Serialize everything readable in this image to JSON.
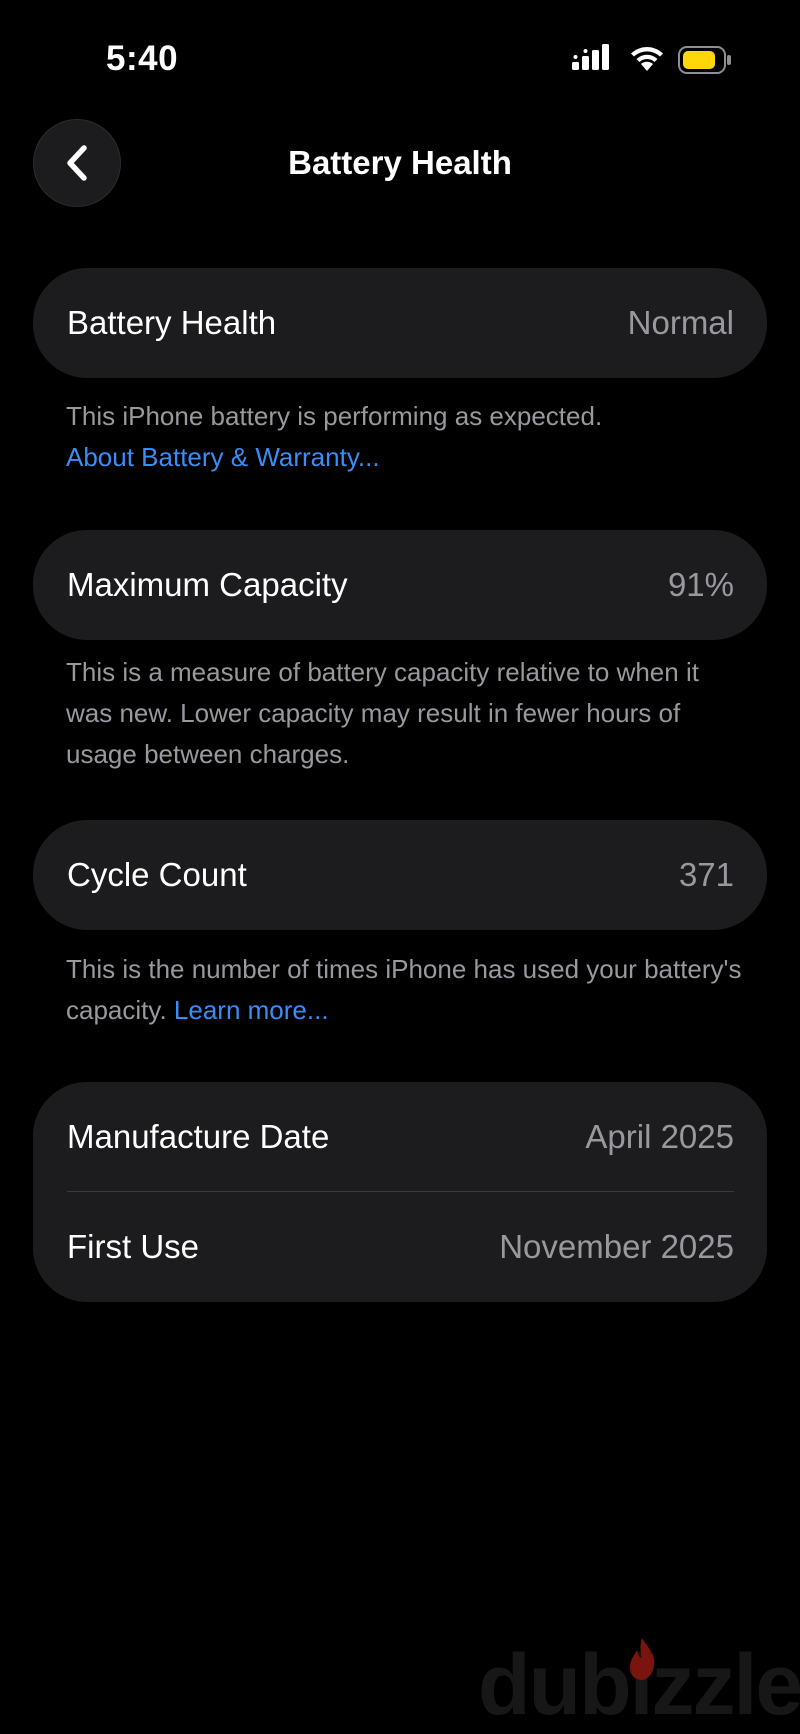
{
  "status_bar": {
    "time": "5:40",
    "icons": [
      "signal-icon",
      "wifi-icon",
      "battery-icon"
    ],
    "battery_color": "#ffd60a"
  },
  "nav": {
    "back_icon": "chevron-left-icon",
    "title": "Battery Health"
  },
  "battery_health": {
    "label": "Battery Health",
    "value": "Normal",
    "footer_text": "This iPhone battery is performing as expected.",
    "footer_link": "About Battery & Warranty..."
  },
  "maximum_capacity": {
    "label": "Maximum Capacity",
    "value": "91%",
    "footer_text": "This is a measure of battery capacity relative to when it was new. Lower capacity may result in fewer hours of usage between charges."
  },
  "cycle_count": {
    "label": "Cycle Count",
    "value": "371",
    "footer_text": "This is the number of times iPhone has used your battery's capacity.",
    "footer_link": "Learn more..."
  },
  "dates": {
    "manufacture_label": "Manufacture Date",
    "manufacture_value": "April 2025",
    "first_use_label": "First Use",
    "first_use_value": "November 2025"
  },
  "watermark": {
    "text": "dubizzle",
    "accent_color": "#e0261b"
  },
  "colors": {
    "background": "#000000",
    "card": "#1c1c1e",
    "secondary_text": "#98989f",
    "link": "#3a8df5"
  }
}
